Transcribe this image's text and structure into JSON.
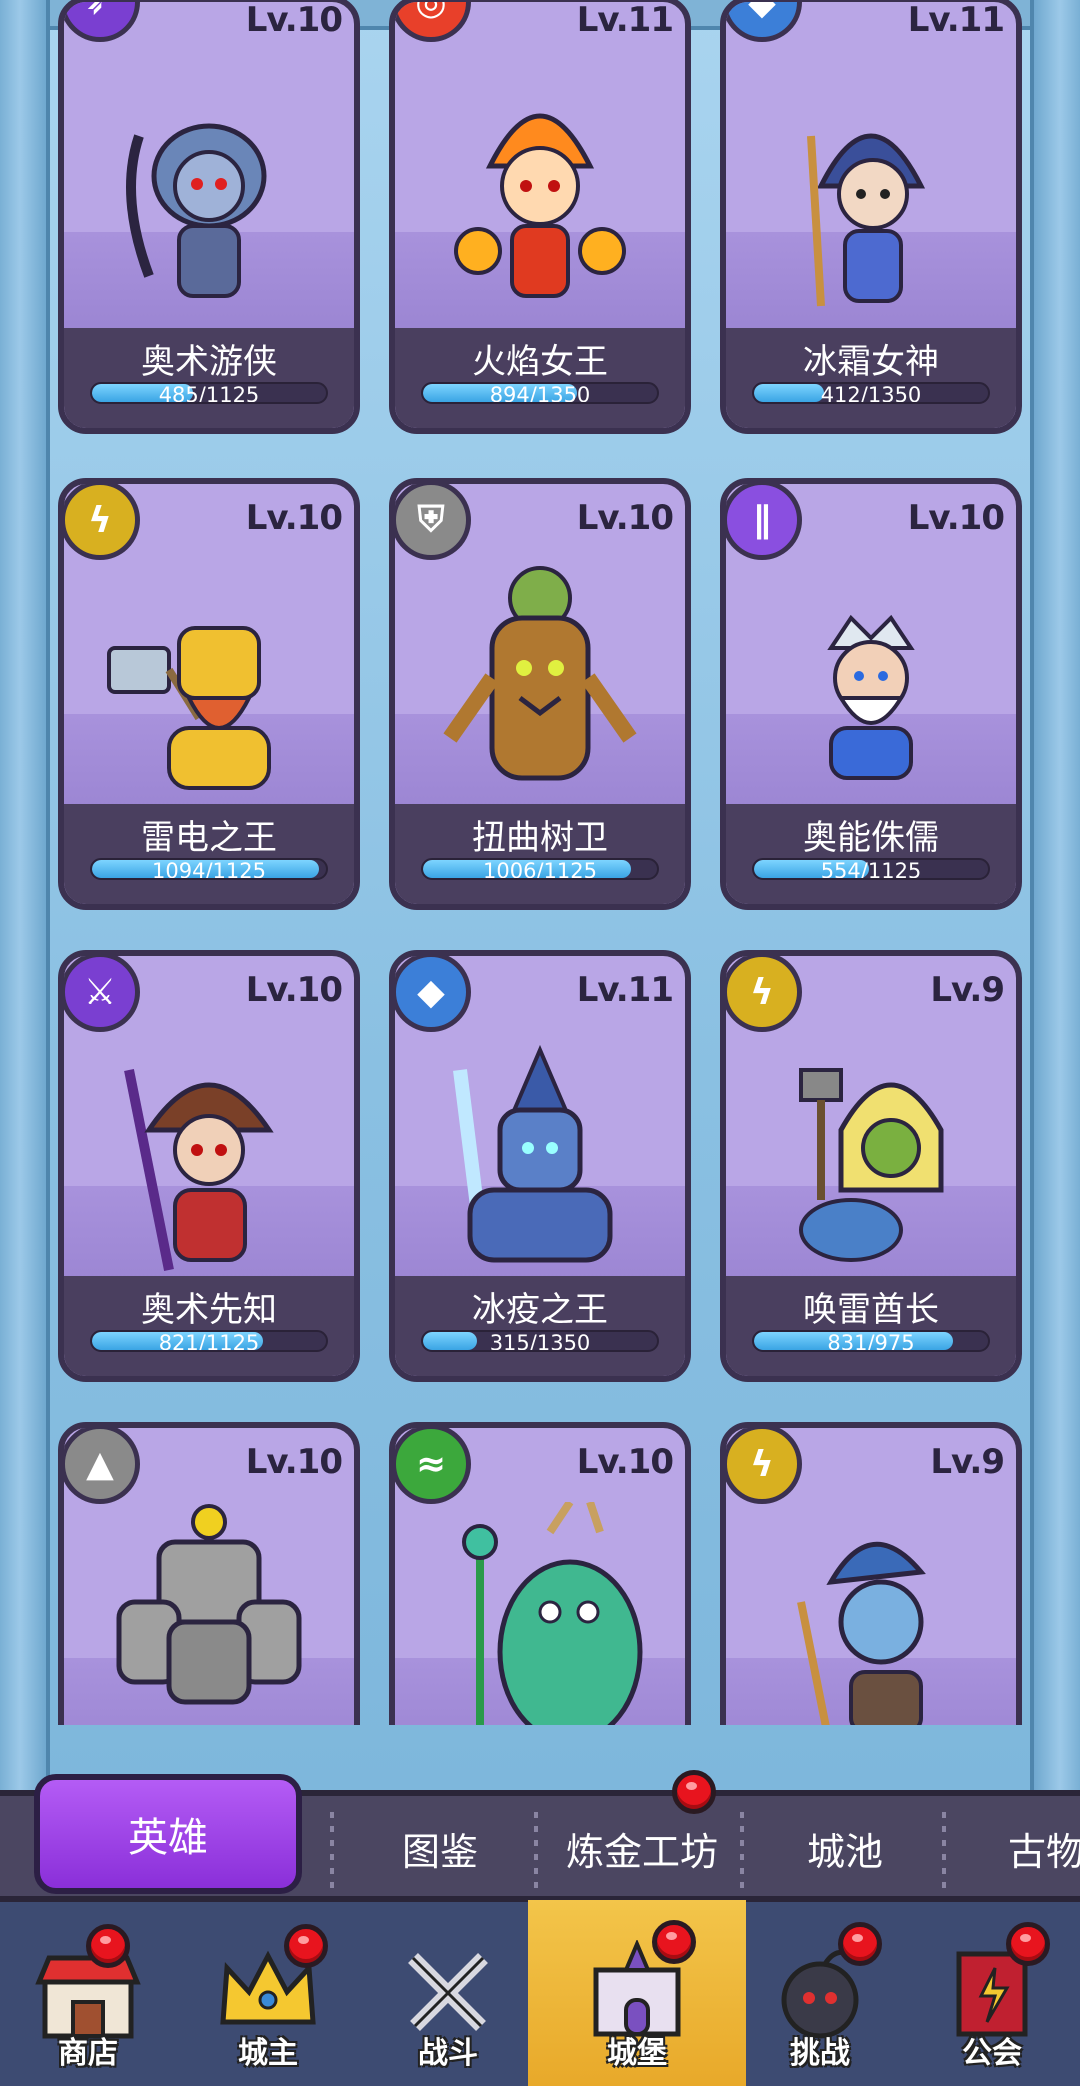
{
  "heroes": [
    {
      "name": "奥术游侠",
      "level": "Lv.10",
      "progress": "485/1125",
      "fill": 0.431,
      "element": "arcane-bow-icon",
      "element_color": "#7a3fd1"
    },
    {
      "name": "火焰女王",
      "level": "Lv.11",
      "progress": "894/1350",
      "fill": 0.662,
      "element": "fire-target-icon",
      "element_color": "#e8402a"
    },
    {
      "name": "冰霜女神",
      "level": "Lv.11",
      "progress": "412/1350",
      "fill": 0.305,
      "element": "ice-crystal-icon",
      "element_color": "#3c7fd8"
    },
    {
      "name": "雷电之王",
      "level": "Lv.10",
      "progress": "1094/1125",
      "fill": 0.972,
      "element": "lightning-icon",
      "element_color": "#d8b020"
    },
    {
      "name": "扭曲树卫",
      "level": "Lv.10",
      "progress": "1006/1125",
      "fill": 0.894,
      "element": "shield-icon",
      "element_color": "#8a8a8a"
    },
    {
      "name": "奥能侏儒",
      "level": "Lv.10",
      "progress": "554/1125",
      "fill": 0.492,
      "element": "arcane-beam-icon",
      "element_color": "#8a4fe0"
    },
    {
      "name": "奥术先知",
      "level": "Lv.10",
      "progress": "821/1125",
      "fill": 0.73,
      "element": "arcane-swords-icon",
      "element_color": "#7a3fd1"
    },
    {
      "name": "冰疫之王",
      "level": "Lv.11",
      "progress": "315/1350",
      "fill": 0.233,
      "element": "ice-crystal-icon",
      "element_color": "#3c7fd8"
    },
    {
      "name": "唤雷酋长",
      "level": "Lv.9",
      "progress": "831/975",
      "fill": 0.852,
      "element": "lightning-icon",
      "element_color": "#d8b020"
    },
    {
      "name": "",
      "level": "Lv.10",
      "progress": "",
      "fill": 0,
      "element": "rock-icon",
      "element_color": "#8a8a8a"
    },
    {
      "name": "",
      "level": "Lv.10",
      "progress": "",
      "fill": 0,
      "element": "wind-icon",
      "element_color": "#3ca83c"
    },
    {
      "name": "",
      "level": "Lv.9",
      "progress": "",
      "fill": 0,
      "element": "lightning-icon",
      "element_color": "#d8b020"
    }
  ],
  "subtabs": {
    "active": "英雄",
    "items": [
      "图鉴",
      "炼金工坊",
      "城池",
      "古物"
    ]
  },
  "nav": [
    {
      "label": "商店",
      "icon": "shop-icon",
      "badge": true
    },
    {
      "label": "城主",
      "icon": "crown-icon",
      "badge": true
    },
    {
      "label": "战斗",
      "icon": "crossed-swords-icon",
      "badge": false
    },
    {
      "label": "城堡",
      "icon": "castle-icon",
      "badge": true,
      "active": true
    },
    {
      "label": "挑战",
      "icon": "bomb-icon",
      "badge": true
    },
    {
      "label": "公会",
      "icon": "guild-banner-icon",
      "badge": true
    }
  ],
  "colors": {
    "accent": "#9b3fe6",
    "nav_active": "#f0bb3c",
    "badge": "#e8141e"
  }
}
